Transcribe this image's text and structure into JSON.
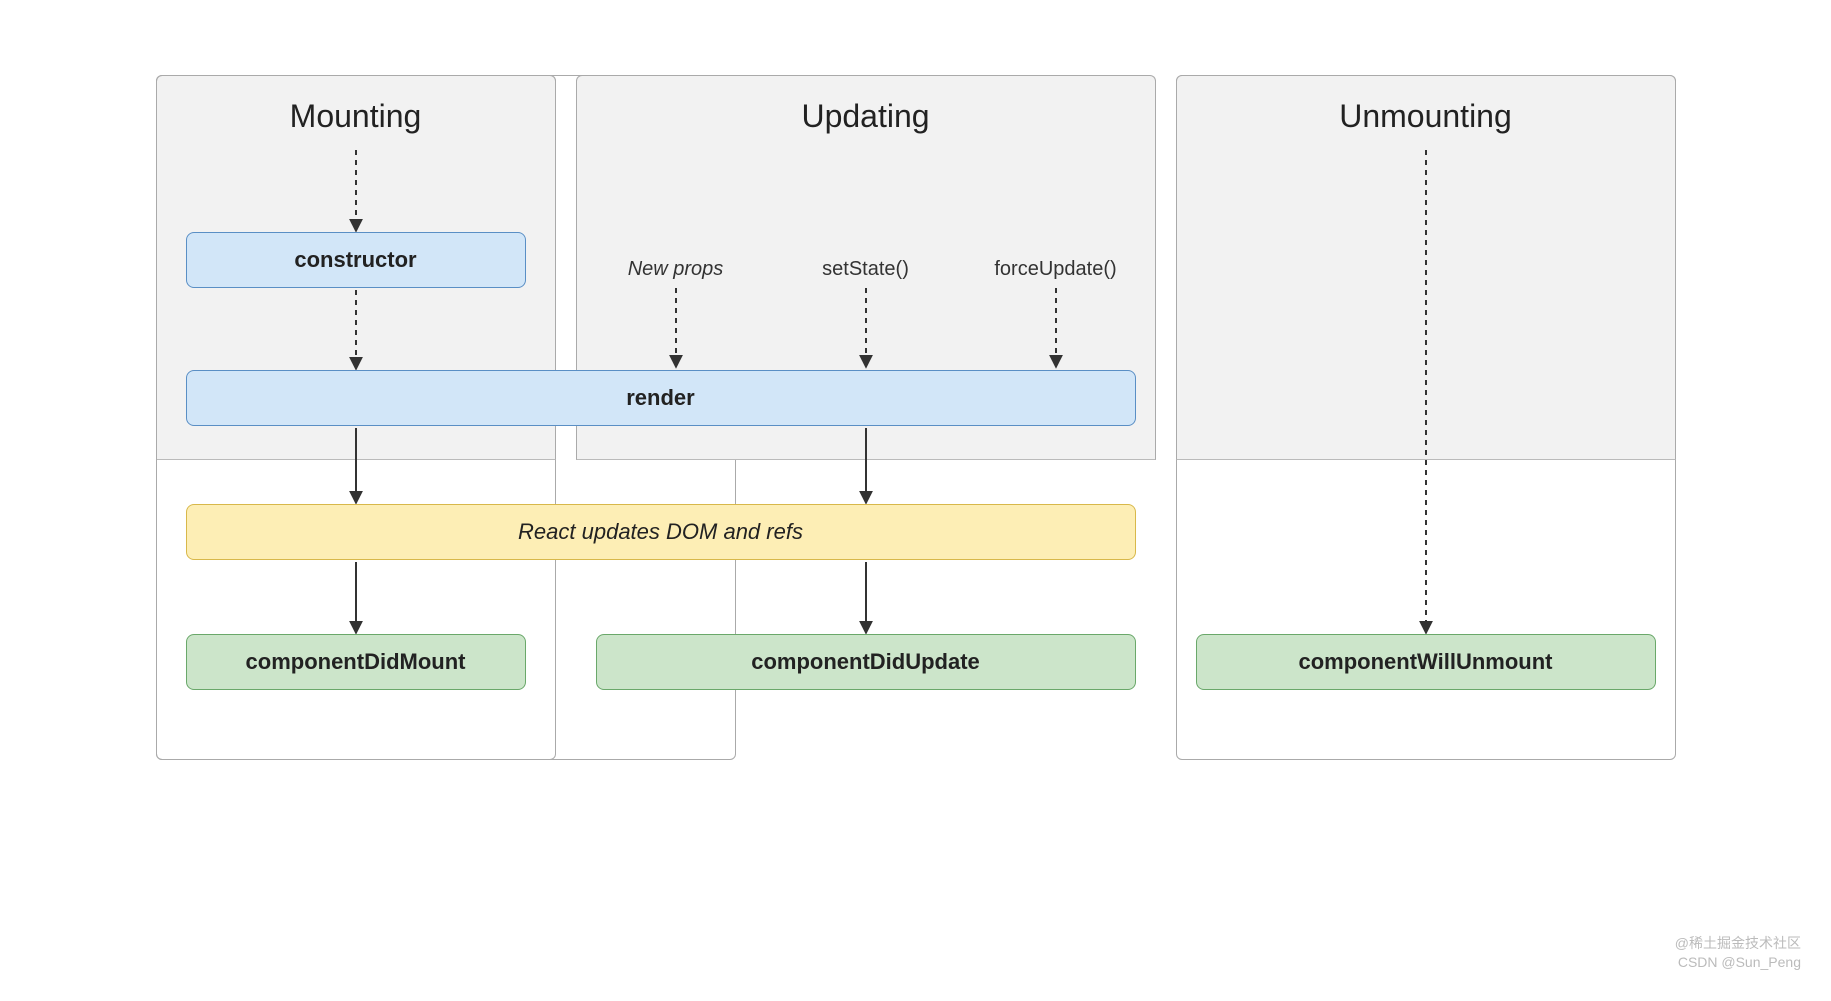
{
  "columns": {
    "mounting": {
      "title": "Mounting"
    },
    "updating": {
      "title": "Updating"
    },
    "unmounting": {
      "title": "Unmounting"
    }
  },
  "boxes": {
    "constructor": "constructor",
    "render": "render",
    "dom_update": "React updates DOM and refs",
    "did_mount": "componentDidMount",
    "did_update": "componentDidUpdate",
    "will_unmount": "componentWillUnmount"
  },
  "triggers": {
    "new_props": "New props",
    "set_state": "setState()",
    "force_update": "forceUpdate()"
  },
  "watermark": {
    "line1": "@稀土掘金技术社区",
    "line2": "CSDN @Sun_Peng"
  }
}
